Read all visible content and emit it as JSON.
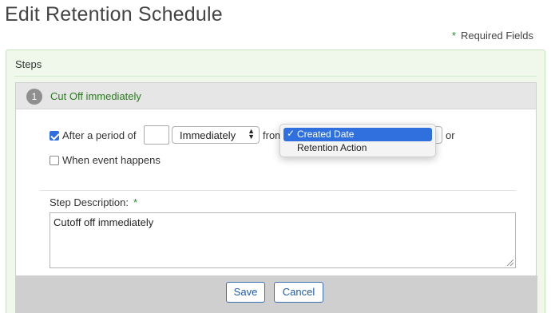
{
  "page": {
    "title": "Edit Retention Schedule",
    "required_fields_star": "*",
    "required_fields_label": "Required Fields"
  },
  "steps": {
    "label": "Steps",
    "step": {
      "number": "1",
      "title": "Cut Off immediately",
      "period": {
        "checked": true,
        "label_prefix": "After a period of",
        "value": "",
        "unit_selected": "Immediately",
        "from_label": "from",
        "or_label": "or"
      },
      "from_dropdown": {
        "options": [
          {
            "label": "Created Date",
            "selected": true
          },
          {
            "label": "Retention Action",
            "selected": false
          }
        ]
      },
      "event": {
        "checked": false,
        "label": "When event happens"
      },
      "description": {
        "label": "Step Description:",
        "required_star": "*",
        "value": "Cutoff off immediately"
      }
    }
  },
  "buttons": {
    "save": "Save",
    "cancel": "Cancel"
  },
  "colors": {
    "accent_green": "#2a7a1e",
    "selection_blue": "#2f6fde",
    "button_blue": "#1f5aa8",
    "panel_green": "#eff8ea"
  }
}
